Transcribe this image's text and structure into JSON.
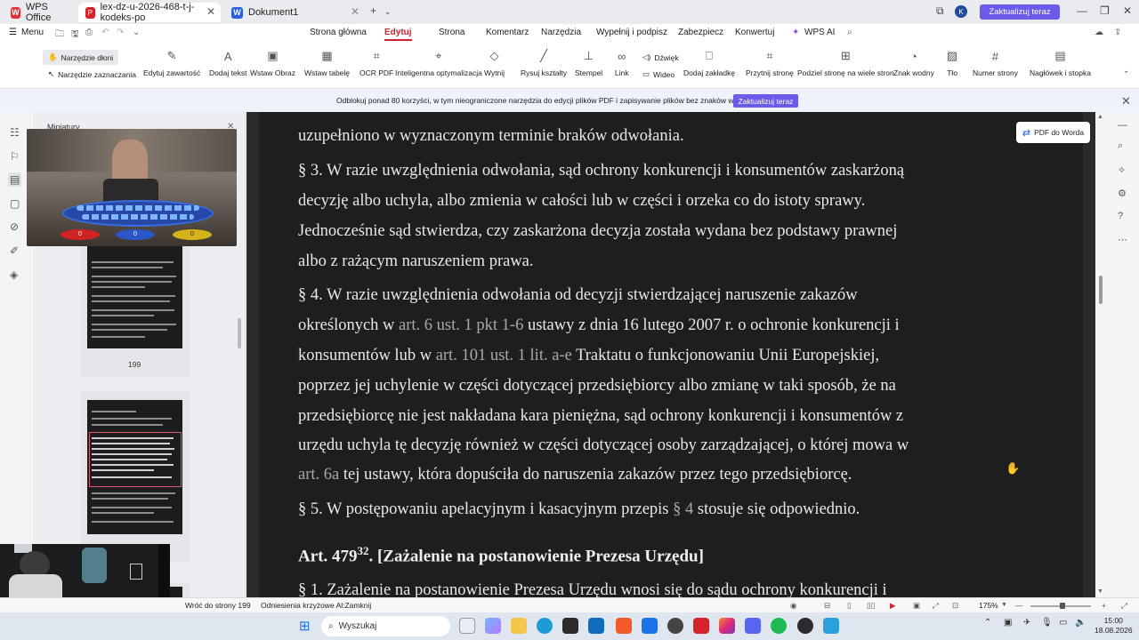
{
  "titlebar": {
    "app_tab": "WPS Office",
    "pdf_tab": "lex-dz-u-2026-468-t-j-kodeks-po",
    "doc_tab": "Dokument1",
    "update_button": "Zaktualizuj teraz",
    "avatar_letter": "K"
  },
  "menu": {
    "menu_label": "Menu",
    "tabs": [
      "Strona główna",
      "Edytuj",
      "Strona",
      "Komentarz",
      "Narzędzia",
      "Wypełnij i podpisz",
      "Zabezpiecz",
      "Konwertuj",
      "WPS AI"
    ],
    "active_tab": "Edytuj"
  },
  "toolbar": {
    "hand_tool": "Narzędzie dłoni",
    "select_tool": "Narzędzie zaznaczania",
    "tools": [
      "Edytuj zawartość",
      "Dodaj tekst",
      "Wstaw Obraz",
      "Wstaw tabelę",
      "OCR PDF",
      "Inteligentna optymalizacja",
      "Wytnij",
      "Rysuj kształty",
      "Stempel",
      "Link",
      "Dodaj zakładkę",
      "Przytnij stronę",
      "Podziel stronę na wiele stron",
      "Znak wodny",
      "Tło",
      "Numer strony",
      "Nagłówek i stopka"
    ],
    "sound": "Dźwięk",
    "video": "Wideo"
  },
  "banner": {
    "text": "Odblokuj ponad 80 korzyści, w tym nieograniczone narzędzia do edycji plików PDF i zapisywanie plików bez znaków wodnych",
    "button": "Zaktualizuj teraz"
  },
  "thumbnails": {
    "panel_title": "Miniatury",
    "page_a": "199"
  },
  "video": {
    "score_left": "0",
    "score_mid": "0",
    "score_right": "0"
  },
  "document": {
    "lines": [
      "uzupełniono w wyznaczonym terminie braków odwołania.",
      "§ 3. W razie uwzględnienia odwołania, sąd ochrony konkurencji i konsumentów zaskarżoną",
      "decyzję albo uchyla, albo zmienia w całości lub w części i orzeka co do istoty sprawy.",
      "Jednocześnie sąd stwierdza, czy zaskarżona decyzja została wydana bez podstawy prawnej",
      "albo z rażącym naruszeniem prawa.",
      "§ 4. W razie uwzględnienia odwołania od decyzji stwierdzającej naruszenie zakazów",
      "określonych w ",
      "art. 6 ust. 1 pkt 1-6",
      " ustawy z dnia 16 lutego 2007 r. o ochronie konkurencji i",
      "konsumentów lub w ",
      "art. 101 ust. 1 lit. a-e",
      " Traktatu o funkcjonowaniu Unii Europejskiej,",
      "poprzez jej uchylenie w części dotyczącej przedsiębiorcy albo zmianę w taki sposób, że na",
      "przedsiębiorcę nie jest nakładana kara pieniężna, sąd ochrony konkurencji i konsumentów z",
      "urzędu uchyla tę decyzję również w części dotyczącej osoby zarządzającej, o której mowa w",
      "art. 6a",
      " tej ustawy, która dopuściła do naruszenia zakazów przez tego przedsiębiorcę.",
      "§ 5. W postępowaniu apelacyjnym i kasacyjnym przepis ",
      "§ 4",
      " stosuje się odpowiednio.",
      "§ 1. Zażalenie na postanowienie Prezesa Urzędu wnosi się do sądu ochrony konkurencji i"
    ],
    "article_prefix": "Art. 479",
    "article_sup": "32",
    "article_suffix": ". [Zażalenie na postanowienie Prezesa Urzędu]",
    "pdf_to_word": "PDF do Worda"
  },
  "statusbar": {
    "back": "Wróć do strony 199",
    "cross_ref": "Odniesienia krzyżowe Al:Zamknij",
    "zoom": "175%"
  },
  "taskbar": {
    "search": "Wyszukaj",
    "time": "15:00",
    "date": "18.08.2026"
  },
  "colors": {
    "accent": "#d0202e",
    "upgrade": "#6a5bea",
    "page_bg": "#1e1e1e"
  }
}
